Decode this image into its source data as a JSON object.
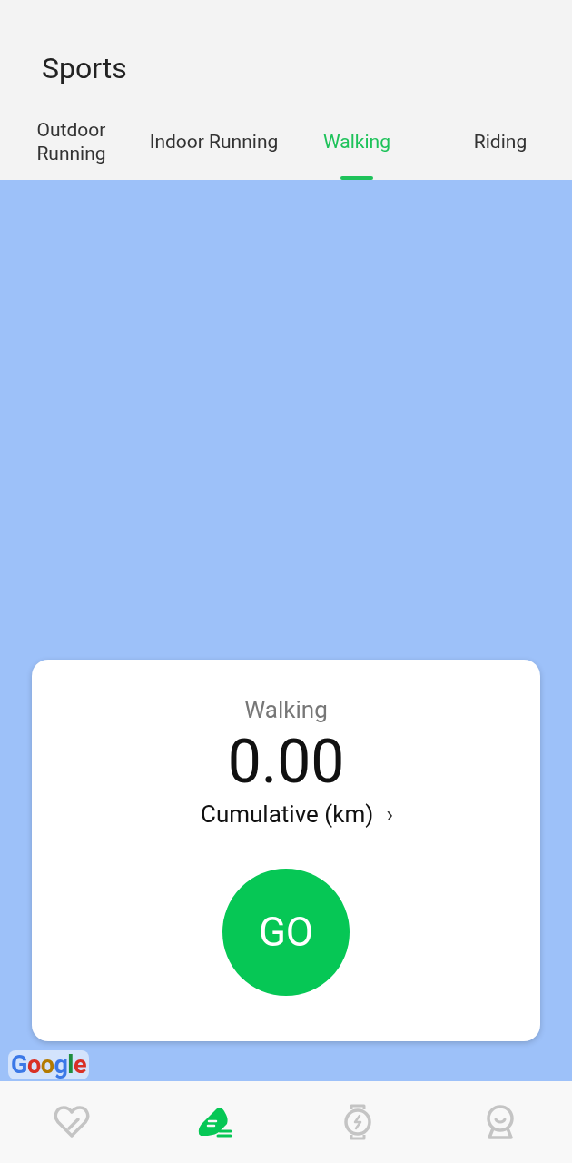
{
  "header": {
    "title": "Sports"
  },
  "tabs": [
    {
      "label": "Outdoor Running",
      "selected": false
    },
    {
      "label": "Indoor Running",
      "selected": false
    },
    {
      "label": "Walking",
      "selected": true
    },
    {
      "label": "Riding",
      "selected": false
    }
  ],
  "map": {
    "attribution": "Google"
  },
  "card": {
    "activity": "Walking",
    "distance": "0.00",
    "metric": "Cumulative (km)",
    "chevron": "›",
    "go_button": "GO"
  },
  "bottom_nav": [
    {
      "selected": false
    },
    {
      "selected": true
    },
    {
      "selected": false
    },
    {
      "selected": false
    }
  ]
}
